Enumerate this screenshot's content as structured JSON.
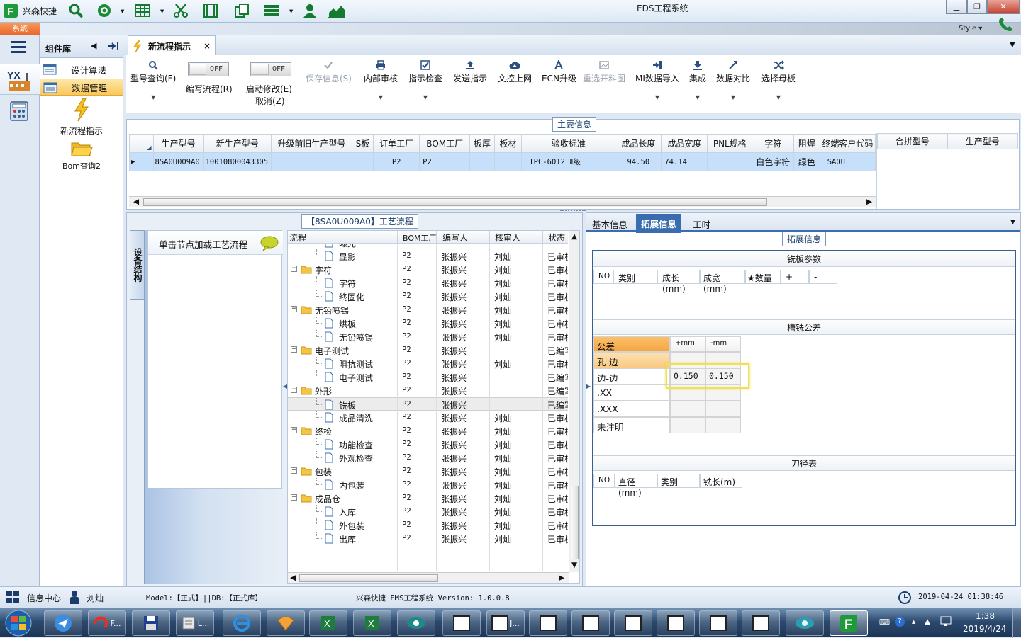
{
  "app": {
    "title": "EDS工程系统",
    "brand": "兴森快捷",
    "style_label": "Style",
    "system_tab": "系统"
  },
  "left_panel": {
    "header": "组件库",
    "items": [
      {
        "label": "设计算法",
        "selected": false
      },
      {
        "label": "数据管理",
        "selected": true
      }
    ],
    "big_items": [
      {
        "label": "新流程指示",
        "icon": "lightning-icon"
      },
      {
        "label": "Bom查询2",
        "icon": "folder-open-icon"
      }
    ]
  },
  "doc_tab": {
    "label": "新流程指示",
    "close": "×"
  },
  "toolbar": {
    "items": [
      {
        "label": "型号查询(F)",
        "icon": "search-icon",
        "enabled": true
      },
      {
        "label": "保存信息(S)",
        "icon": "check-icon",
        "enabled": false
      },
      {
        "label": "内部审核",
        "icon": "printer-icon",
        "enabled": true
      },
      {
        "label": "指示检查",
        "icon": "checkbox-icon",
        "enabled": true
      },
      {
        "label": "发送指示",
        "icon": "upload-icon",
        "enabled": true
      },
      {
        "label": "文控上网",
        "icon": "cloud-upload-icon",
        "enabled": true
      },
      {
        "label": "ECN升级",
        "icon": "ecn-icon",
        "enabled": true
      },
      {
        "label": "重选开料图",
        "icon": "image-icon",
        "enabled": false
      },
      {
        "label": "MI数据导入",
        "icon": "import-icon",
        "enabled": true
      },
      {
        "label": "集成",
        "icon": "download-icon",
        "enabled": true
      },
      {
        "label": "数据对比",
        "icon": "compare-icon",
        "enabled": true
      },
      {
        "label": "选择母板",
        "icon": "shuffle-icon",
        "enabled": true
      }
    ],
    "toggle1": {
      "state": "OFF",
      "label": "编写流程(R)"
    },
    "toggle2": {
      "state": "OFF",
      "label1": "启动修改(E)",
      "label2": "取消(Z)"
    }
  },
  "main_info": {
    "section_label": "主要信息",
    "columns": [
      "生产型号",
      "新生产型号",
      "升级前旧生产型号",
      "S板",
      "订单工厂",
      "BOM工厂",
      "板厚",
      "板材",
      "验收标准",
      "成品长度",
      "成品宽度",
      "PNL规格",
      "字符",
      "阻焊",
      "终端客户代码"
    ],
    "row": [
      "8SA0U009A0",
      "10010800043305",
      "",
      "",
      "P2",
      "P2",
      "",
      "",
      "IPC-6012 Ⅱ级",
      "94.50",
      "74.14",
      "",
      "白色字符",
      "绿色",
      "SAOU"
    ],
    "side_columns": [
      "合拼型号",
      "生产型号"
    ]
  },
  "process": {
    "section_label": "【8SA0U009A0】工艺流程",
    "vtab": "设备结构",
    "hint": "单击节点加载工艺流程",
    "columns": [
      "流程",
      "BOM工厂",
      "编写人",
      "核审人",
      "状态"
    ],
    "rows": [
      {
        "name": "曝光",
        "level": 2,
        "bom": "P2",
        "writer": "",
        "reviewer": "",
        "status": ""
      },
      {
        "name": "显影",
        "level": 2,
        "bom": "P2",
        "writer": "张振兴",
        "reviewer": "刘灿",
        "status": "已审核"
      },
      {
        "name": "字符",
        "level": 1,
        "bom": "P2",
        "writer": "张振兴",
        "reviewer": "刘灿",
        "status": "已审核"
      },
      {
        "name": "字符",
        "level": 2,
        "bom": "P2",
        "writer": "张振兴",
        "reviewer": "刘灿",
        "status": "已审核"
      },
      {
        "name": "终固化",
        "level": 2,
        "bom": "P2",
        "writer": "张振兴",
        "reviewer": "刘灿",
        "status": "已审核"
      },
      {
        "name": "无铅喷锡",
        "level": 1,
        "bom": "P2",
        "writer": "张振兴",
        "reviewer": "刘灿",
        "status": "已审核"
      },
      {
        "name": "烘板",
        "level": 2,
        "bom": "P2",
        "writer": "张振兴",
        "reviewer": "刘灿",
        "status": "已审核"
      },
      {
        "name": "无铅喷锡",
        "level": 2,
        "bom": "P2",
        "writer": "张振兴",
        "reviewer": "刘灿",
        "status": "已审核"
      },
      {
        "name": "电子测试",
        "level": 1,
        "bom": "P2",
        "writer": "张振兴",
        "reviewer": "",
        "status": "已编写"
      },
      {
        "name": "阻抗测试",
        "level": 2,
        "bom": "P2",
        "writer": "张振兴",
        "reviewer": "刘灿",
        "status": "已审核"
      },
      {
        "name": "电子测试",
        "level": 2,
        "bom": "P2",
        "writer": "张振兴",
        "reviewer": "",
        "status": "已编写"
      },
      {
        "name": "外形",
        "level": 1,
        "bom": "P2",
        "writer": "张振兴",
        "reviewer": "",
        "status": "已编写"
      },
      {
        "name": "铣板",
        "level": 2,
        "bom": "P2",
        "writer": "张振兴",
        "reviewer": "",
        "status": "已编写",
        "selected": true
      },
      {
        "name": "成品清洗",
        "level": 2,
        "bom": "P2",
        "writer": "张振兴",
        "reviewer": "刘灿",
        "status": "已审核"
      },
      {
        "name": "终检",
        "level": 1,
        "bom": "P2",
        "writer": "张振兴",
        "reviewer": "刘灿",
        "status": "已审核"
      },
      {
        "name": "功能检查",
        "level": 2,
        "bom": "P2",
        "writer": "张振兴",
        "reviewer": "刘灿",
        "status": "已审核"
      },
      {
        "name": "外观检查",
        "level": 2,
        "bom": "P2",
        "writer": "张振兴",
        "reviewer": "刘灿",
        "status": "已审核"
      },
      {
        "name": "包装",
        "level": 1,
        "bom": "P2",
        "writer": "张振兴",
        "reviewer": "刘灿",
        "status": "已审核"
      },
      {
        "name": "内包装",
        "level": 2,
        "bom": "P2",
        "writer": "张振兴",
        "reviewer": "刘灿",
        "status": "已审核"
      },
      {
        "name": "成品仓",
        "level": 1,
        "bom": "P2",
        "writer": "张振兴",
        "reviewer": "刘灿",
        "status": "已审核"
      },
      {
        "name": "入库",
        "level": 2,
        "bom": "P2",
        "writer": "张振兴",
        "reviewer": "刘灿",
        "status": "已审核"
      },
      {
        "name": "外包装",
        "level": 2,
        "bom": "P2",
        "writer": "张振兴",
        "reviewer": "刘灿",
        "status": "已审核"
      },
      {
        "name": "出库",
        "level": 2,
        "bom": "P2",
        "writer": "张振兴",
        "reviewer": "刘灿",
        "status": "已审核"
      }
    ]
  },
  "right": {
    "tabs": [
      "基本信息",
      "拓展信息",
      "工时"
    ],
    "section_label": "拓展信息",
    "mill_params": {
      "title": "铣板参数",
      "columns": [
        "NO",
        "类别",
        "成长(mm)",
        "成宽(mm)",
        "★数量",
        "+",
        "-"
      ]
    },
    "mill_tolerance": {
      "title": "槽铣公差",
      "header": [
        "公差",
        "+mm",
        "-mm"
      ],
      "rows": [
        [
          "孔-边",
          "",
          ""
        ],
        [
          "边-边",
          "0.150",
          "0.150"
        ],
        [
          ".XX",
          "",
          ""
        ],
        [
          ".XXX",
          "",
          ""
        ],
        [
          "未注明",
          "",
          ""
        ]
      ]
    },
    "tool_table": {
      "title": "刀径表",
      "columns": [
        "NO",
        "直径(mm)",
        "类别",
        "铣长(m)"
      ]
    }
  },
  "status": {
    "info_center": "信息中心",
    "user": "刘灿",
    "model": "Model:【正式】||DB:【正式库】",
    "version": "兴森快捷  EMS工程系统  Version: 1.0.0.8",
    "datetime": "2019-04-24 01:38:46"
  },
  "taskbar": {
    "time": "1:38",
    "date": "2019/4/24",
    "items": [
      "F...",
      "L...",
      "J..."
    ]
  }
}
